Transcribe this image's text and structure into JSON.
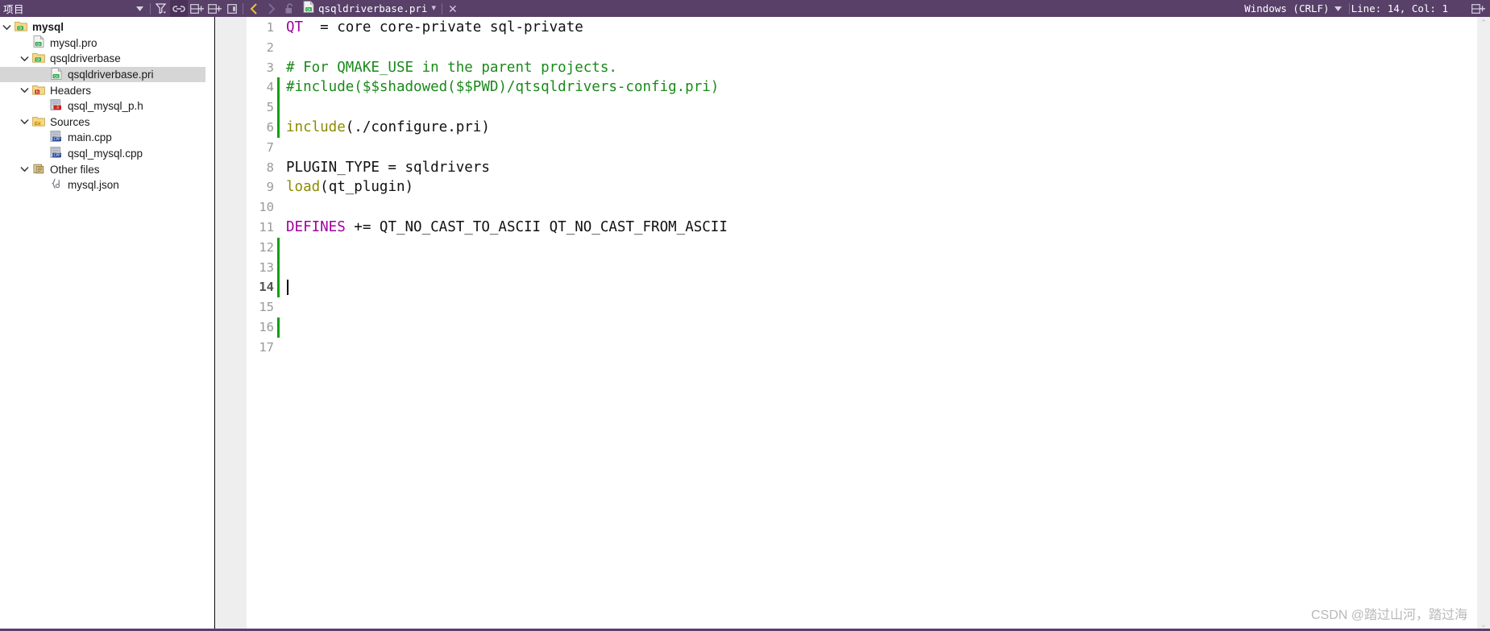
{
  "window": {
    "project_panel_title": "项目",
    "panel_toolbar": [
      {
        "name": "filter-dropdown-caret-icon",
        "glyph": "caret-down"
      },
      {
        "name": "filter-icon",
        "glyph": "filter"
      },
      {
        "name": "link-with-editor-icon",
        "glyph": "link",
        "active": true
      },
      {
        "name": "split-add-icon",
        "glyph": "split-add"
      }
    ],
    "editor_toolbar": [
      {
        "name": "split-add-icon",
        "glyph": "split-add"
      },
      {
        "name": "close-split-icon",
        "glyph": "close-split"
      },
      {
        "name": "navigate-back-icon",
        "glyph": "chevron-left",
        "enabled": true
      },
      {
        "name": "navigate-forward-icon",
        "glyph": "chevron-right",
        "enabled": false
      },
      {
        "name": "unlock-icon",
        "glyph": "unlock"
      }
    ],
    "status": {
      "line_ending": "Windows (CRLF)",
      "cursor_position": "Line: 14, Col: 1"
    },
    "watermark": "CSDN @踏过山河，踏过海"
  },
  "tab": {
    "label": "qsqldriverbase.pri",
    "icon": "qt-file-icon",
    "caret": "▾",
    "close": "✕"
  },
  "tree": {
    "items": [
      {
        "label": "mysql",
        "indent": 0,
        "arrow": "down",
        "icon": "qt-project-folder-icon",
        "bold": true,
        "selected": false
      },
      {
        "label": "mysql.pro",
        "indent": 1,
        "arrow": "none",
        "icon": "qt-file-icon",
        "bold": false,
        "selected": false
      },
      {
        "label": "qsqldriverbase",
        "indent": 1,
        "arrow": "down",
        "icon": "qt-project-folder-icon",
        "bold": false,
        "selected": false
      },
      {
        "label": "qsqldriverbase.pri",
        "indent": 2,
        "arrow": "none",
        "icon": "qt-file-icon",
        "bold": false,
        "selected": true
      },
      {
        "label": "Headers",
        "indent": 1,
        "arrow": "down",
        "icon": "headers-folder-icon",
        "bold": false,
        "selected": false
      },
      {
        "label": "qsql_mysql_p.h",
        "indent": 2,
        "arrow": "none",
        "icon": "header-file-icon",
        "bold": false,
        "selected": false
      },
      {
        "label": "Sources",
        "indent": 1,
        "arrow": "down",
        "icon": "sources-folder-icon",
        "bold": false,
        "selected": false
      },
      {
        "label": "main.cpp",
        "indent": 2,
        "arrow": "none",
        "icon": "cpp-file-icon",
        "bold": false,
        "selected": false
      },
      {
        "label": "qsql_mysql.cpp",
        "indent": 2,
        "arrow": "none",
        "icon": "cpp-file-icon",
        "bold": false,
        "selected": false
      },
      {
        "label": "Other files",
        "indent": 1,
        "arrow": "down",
        "icon": "other-files-folder-icon",
        "bold": false,
        "selected": false
      },
      {
        "label": "mysql.json",
        "indent": 2,
        "arrow": "none",
        "icon": "json-file-icon",
        "bold": false,
        "selected": false
      }
    ]
  },
  "editor": {
    "current_line": 14,
    "lines": [
      {
        "n": 1,
        "changed": false,
        "tokens": [
          {
            "t": "QT",
            "c": "var"
          },
          {
            "t": "  = core core-private sql-private",
            "c": "pl"
          }
        ]
      },
      {
        "n": 2,
        "changed": false,
        "tokens": []
      },
      {
        "n": 3,
        "changed": false,
        "tokens": [
          {
            "t": "# For QMAKE_USE in the parent projects.",
            "c": "com"
          }
        ]
      },
      {
        "n": 4,
        "changed": true,
        "tokens": [
          {
            "t": "#include($$shadowed($$PWD)/qtsqldrivers-config.pri)",
            "c": "com"
          }
        ]
      },
      {
        "n": 5,
        "changed": true,
        "tokens": []
      },
      {
        "n": 6,
        "changed": true,
        "tokens": [
          {
            "t": "include",
            "c": "fn"
          },
          {
            "t": "(./configure.pri)",
            "c": "pl"
          }
        ]
      },
      {
        "n": 7,
        "changed": false,
        "tokens": []
      },
      {
        "n": 8,
        "changed": false,
        "tokens": [
          {
            "t": "PLUGIN_TYPE = sqldrivers",
            "c": "pl"
          }
        ]
      },
      {
        "n": 9,
        "changed": false,
        "tokens": [
          {
            "t": "load",
            "c": "fn"
          },
          {
            "t": "(qt_plugin)",
            "c": "pl"
          }
        ]
      },
      {
        "n": 10,
        "changed": false,
        "tokens": []
      },
      {
        "n": 11,
        "changed": false,
        "tokens": [
          {
            "t": "DEFINES",
            "c": "var"
          },
          {
            "t": " += QT_NO_CAST_TO_ASCII QT_NO_CAST_FROM_ASCII",
            "c": "pl"
          }
        ]
      },
      {
        "n": 12,
        "changed": true,
        "tokens": []
      },
      {
        "n": 13,
        "changed": true,
        "tokens": []
      },
      {
        "n": 14,
        "changed": true,
        "tokens": []
      },
      {
        "n": 15,
        "changed": false,
        "tokens": []
      },
      {
        "n": 16,
        "changed": true,
        "tokens": []
      },
      {
        "n": 17,
        "changed": false,
        "tokens": []
      }
    ]
  },
  "scrollbar": {
    "up_arrow": "⌃",
    "down_arrow": "⌄"
  }
}
